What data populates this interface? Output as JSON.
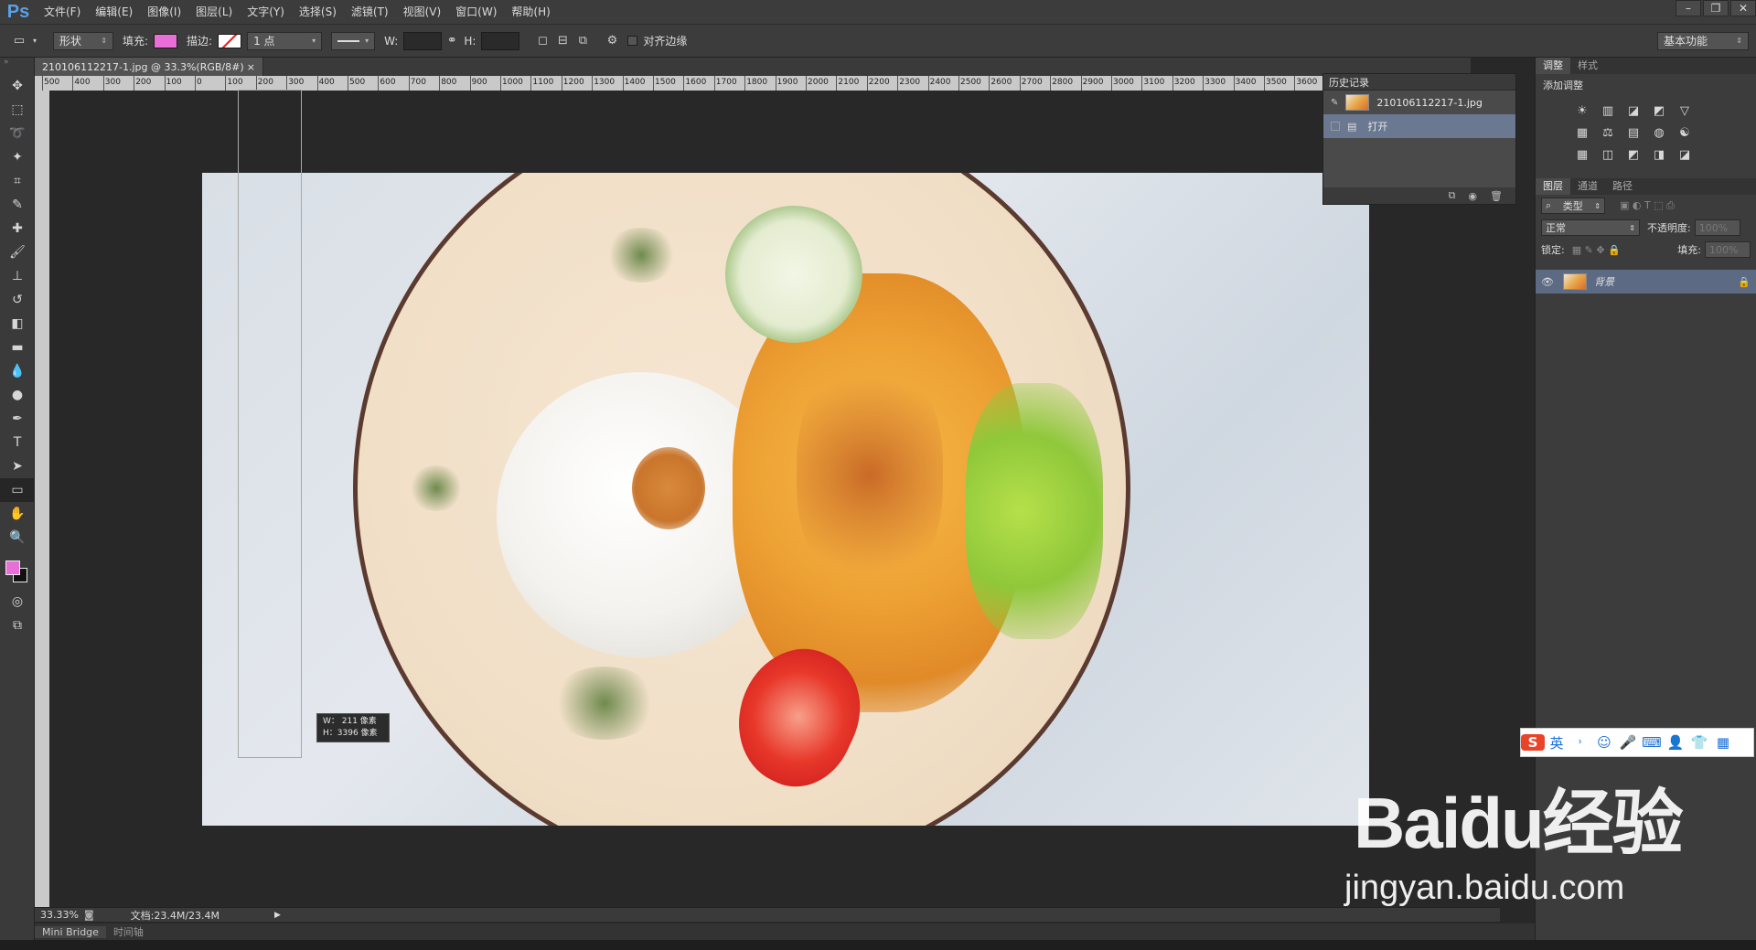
{
  "app": {
    "logo": "Ps",
    "menu": [
      "文件(F)",
      "编辑(E)",
      "图像(I)",
      "图层(L)",
      "文字(Y)",
      "选择(S)",
      "滤镜(T)",
      "视图(V)",
      "窗口(W)",
      "帮助(H)"
    ],
    "window_buttons": [
      "–",
      "❐",
      "✕"
    ]
  },
  "options": {
    "shape_mode": "形状",
    "fill_label": "填充:",
    "fill_color": "#e86fd8",
    "stroke_label": "描边:",
    "stroke_size": "1 点",
    "w_label": "W:",
    "h_label": "H:",
    "align_edges": "对齐边缘",
    "workspace": "基本功能"
  },
  "document": {
    "tab_title": "210106112217-1.jpg @ 33.3%(RGB/8#)",
    "tab_close": "×",
    "ruler_labels": [
      "500",
      "400",
      "300",
      "200",
      "100",
      "0",
      "100",
      "200",
      "300",
      "400",
      "500",
      "600",
      "700",
      "800",
      "900",
      "1000",
      "1100",
      "1200",
      "1300",
      "1400",
      "1500",
      "1600",
      "1700",
      "1800",
      "1900",
      "2000",
      "2100",
      "2200",
      "2300",
      "2400",
      "2500",
      "2600",
      "2700",
      "2800",
      "2900",
      "3000",
      "3100",
      "3200",
      "3300",
      "3400",
      "3500",
      "3600"
    ],
    "tooltip_w": "W：  211 像素",
    "tooltip_h": "H：3396 像素"
  },
  "status": {
    "zoom": "33.33%",
    "doc_size": "文档:23.4M/23.4M"
  },
  "bottom_tabs": [
    "Mini Bridge",
    "时间轴"
  ],
  "history": {
    "title": "历史记录",
    "snapshot": "210106112217-1.jpg",
    "items": [
      "打开"
    ]
  },
  "right": {
    "adj_tabs": [
      "调整",
      "样式"
    ],
    "adj_title": "添加调整",
    "adj_icons": [
      "☀",
      "▥",
      "◪",
      "◩",
      "▽",
      "▦",
      "⚖",
      "▤",
      "◍",
      "☯",
      "▦",
      "◫",
      "◩",
      "◨",
      "◪"
    ],
    "layer_tabs": [
      "图层",
      "通道",
      "路径"
    ],
    "kind": "类型",
    "blend": "正常",
    "opacity_label": "不透明度:",
    "opacity": "100%",
    "lock_label": "锁定:",
    "fill_label": "填充:",
    "fill": "100%",
    "layer_name": "背景"
  },
  "ime": [
    "S",
    "英",
    "˒",
    "☺",
    "🎤",
    "⌨",
    "👤",
    "👕",
    "▦"
  ],
  "watermark": {
    "line1": "Baiḋu经验",
    "line2": "jingyan.baidu.com"
  }
}
